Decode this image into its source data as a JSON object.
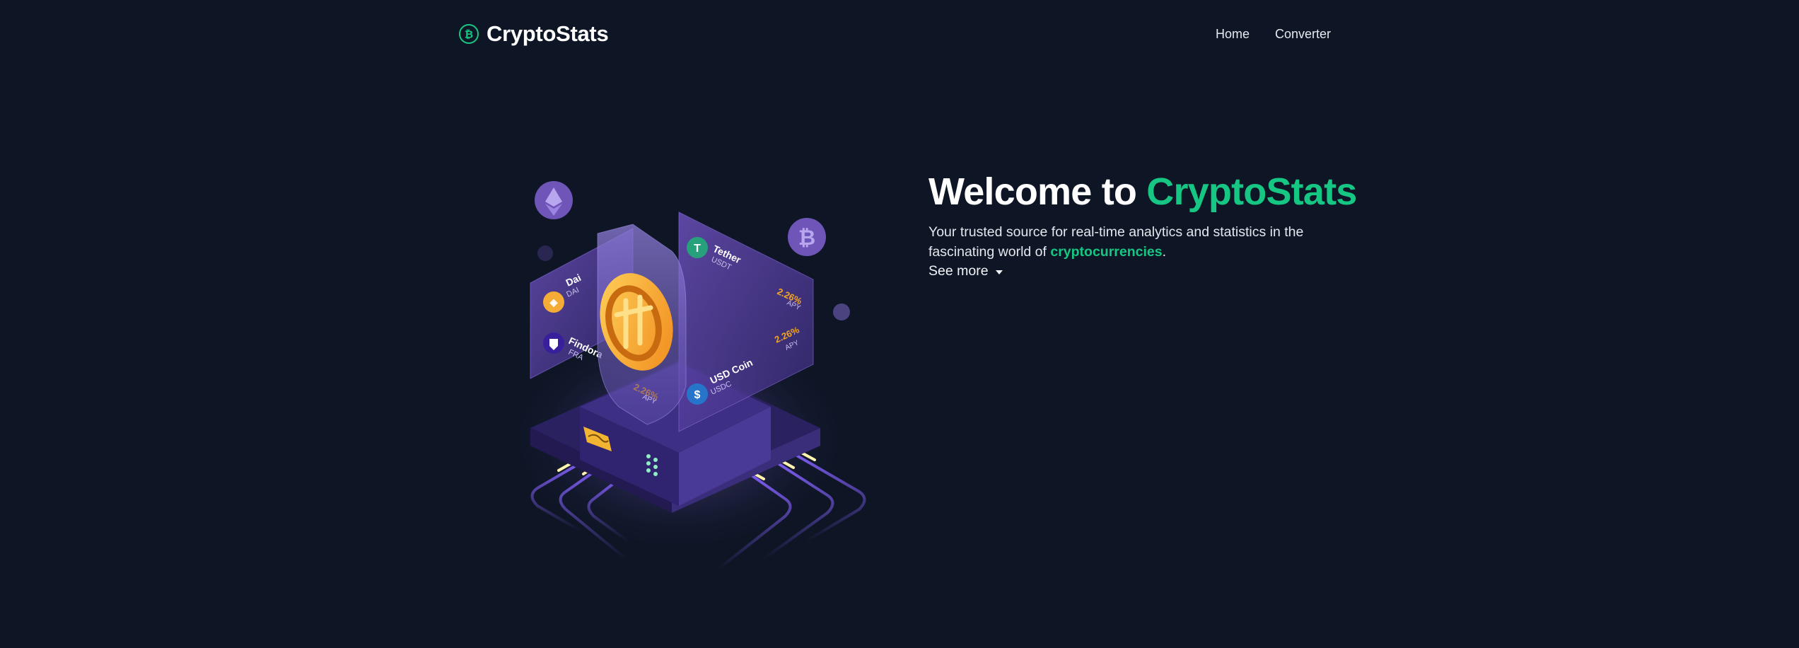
{
  "navbar": {
    "brand_icon": "bitcoin-circle-icon",
    "brand_text": "CryptoStats",
    "brand_color": "#16c784",
    "links": [
      {
        "label": "Home"
      },
      {
        "label": "Converter"
      }
    ]
  },
  "hero": {
    "title_prefix": "Welcome to ",
    "title_accent": "CryptoStats",
    "description_before": "Your trusted source for real-time analytics and statistics in the fascinating world of ",
    "description_accent": "cryptocurrencies",
    "description_after": ".",
    "see_more_label": "See more",
    "see_more_icon": "caret-down-icon"
  },
  "illustration": {
    "floating_icons": [
      "ethereum-icon",
      "bitcoin-icon"
    ],
    "cards": [
      {
        "name": "Dai",
        "symbol": "DAI",
        "icon": "dai-icon"
      },
      {
        "name": "Findora",
        "symbol": "FRA",
        "icon": "findora-icon"
      },
      {
        "name": "Tether",
        "symbol": "USDT",
        "icon": "tether-icon",
        "rate": "2.26%",
        "rate_label": "APY"
      },
      {
        "name": "USD Coin",
        "symbol": "USDC",
        "icon": "usdc-icon",
        "rate": "2.26%",
        "rate_label": "APY"
      },
      {
        "rate": "2.26%",
        "rate_label": "APY"
      }
    ]
  },
  "colors": {
    "background": "#0e1626",
    "accent": "#16c784",
    "rate_orange": "#f5a623",
    "platform_purple": "#3d2f84"
  }
}
